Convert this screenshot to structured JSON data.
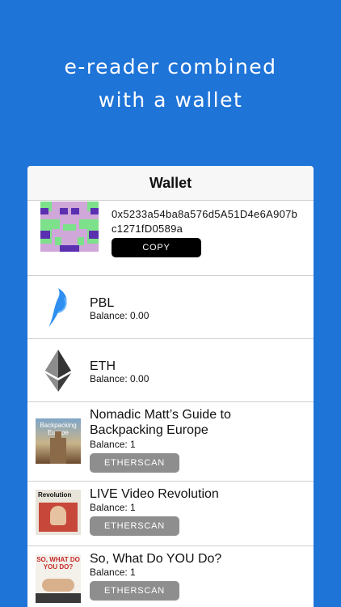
{
  "headline": {
    "line1": "e-reader combined",
    "line2": "with a wallet"
  },
  "wallet": {
    "title": "Wallet",
    "address": "0x5233a54ba8a576d5A51D4e6A907bc1271fD0589a",
    "copy_label": "COPY"
  },
  "tokens": [
    {
      "name": "PBL",
      "balance": "Balance: 0.00",
      "icon": "pbl-logo-icon"
    },
    {
      "name": "ETH",
      "balance": "Balance: 0.00",
      "icon": "ethereum-logo-icon"
    }
  ],
  "books": [
    {
      "title": "Nomadic Matt’s Guide to Backpacking Europe",
      "balance": "Balance: 1",
      "button": "ETHERSCAN",
      "cover_text": "Backpacking Europe"
    },
    {
      "title": "LIVE Video Revolution",
      "balance": "Balance: 1",
      "button": "ETHERSCAN",
      "cover_text": "Revolution"
    },
    {
      "title": "So, What Do YOU Do?",
      "balance": "Balance: 1",
      "button": "ETHERSCAN",
      "cover_text": "SO, WHAT DO YOU DO?"
    }
  ],
  "colors": {
    "background": "#1f74d8",
    "copy_button": "#000000",
    "etherscan_button": "#8e8e8e",
    "pbl_blue": "#2f8ff0"
  }
}
